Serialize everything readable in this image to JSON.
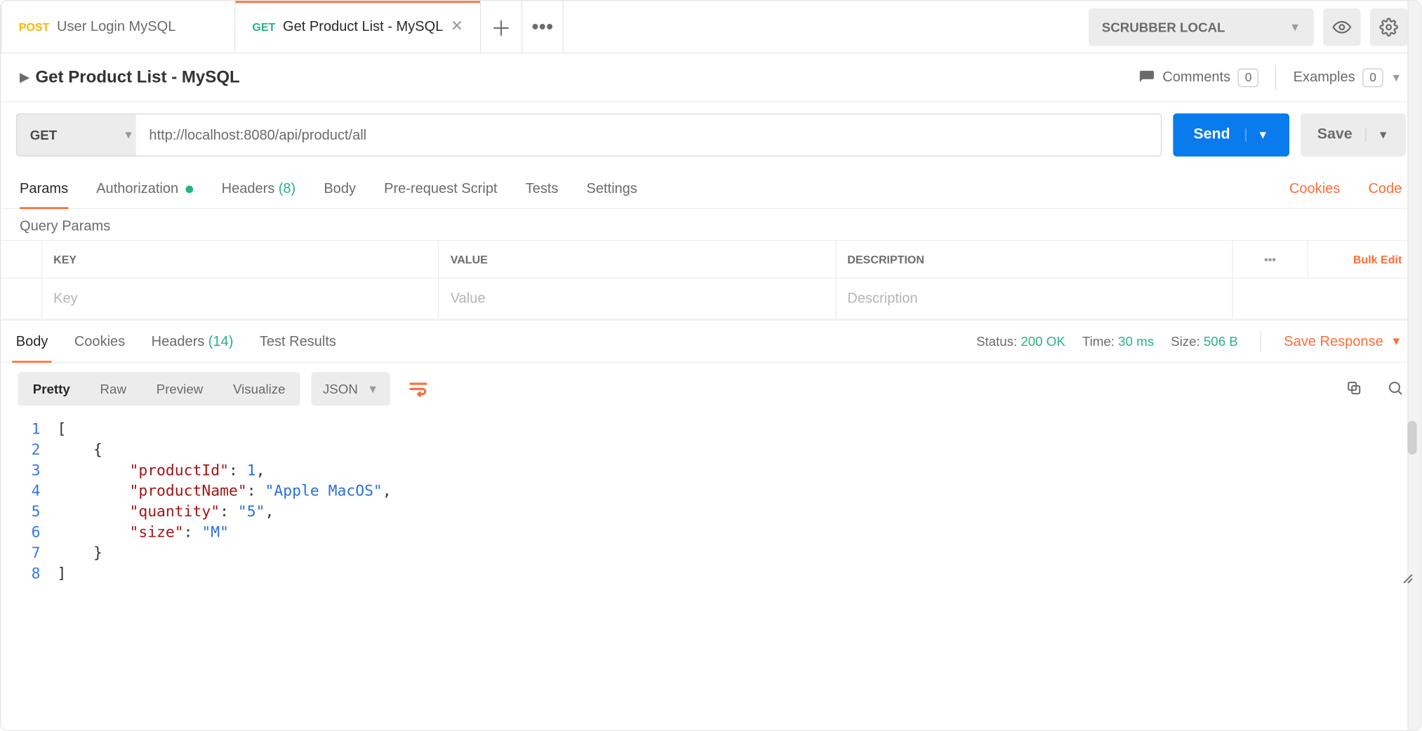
{
  "environment": {
    "name": "SCRUBBER LOCAL"
  },
  "tabs": [
    {
      "method": "POST",
      "title": "User Login MySQL",
      "active": false
    },
    {
      "method": "GET",
      "title": "Get Product List - MySQL",
      "active": true
    }
  ],
  "request": {
    "name": "Get Product List - MySQL",
    "comments": {
      "label": "Comments",
      "count": "0"
    },
    "examples": {
      "label": "Examples",
      "count": "0"
    },
    "method": "GET",
    "url": "http://localhost:8080/api/product/all",
    "send_label": "Send",
    "save_label": "Save"
  },
  "request_tabs": {
    "params": "Params",
    "authorization": "Authorization",
    "headers": "Headers",
    "headers_count": "(8)",
    "body": "Body",
    "prerequest": "Pre-request Script",
    "tests": "Tests",
    "settings": "Settings",
    "cookies_link": "Cookies",
    "code_link": "Code"
  },
  "query_params": {
    "section_label": "Query Params",
    "head": {
      "key": "KEY",
      "value": "VALUE",
      "description": "DESCRIPTION",
      "bulk_edit": "Bulk Edit"
    },
    "placeholders": {
      "key": "Key",
      "value": "Value",
      "description": "Description"
    }
  },
  "response_tabs": {
    "body": "Body",
    "cookies": "Cookies",
    "headers": "Headers",
    "headers_count": "(14)",
    "test_results": "Test Results"
  },
  "response_meta": {
    "status_lbl": "Status:",
    "status_val": "200 OK",
    "time_lbl": "Time:",
    "time_val": "30 ms",
    "size_lbl": "Size:",
    "size_val": "506 B",
    "save_response": "Save Response"
  },
  "response_toolbar": {
    "pretty": "Pretty",
    "raw": "Raw",
    "preview": "Preview",
    "visualize": "Visualize",
    "format": "JSON"
  },
  "response_body": {
    "lines": [
      "1",
      "2",
      "3",
      "4",
      "5",
      "6",
      "7",
      "8"
    ],
    "l1": "[",
    "l2_indent": "    ",
    "l2": "{",
    "kv_indent": "        ",
    "k1": "\"productId\"",
    "v1": "1",
    "k2": "\"productName\"",
    "v2": "\"Apple MacOS\"",
    "k3": "\"quantity\"",
    "v3": "\"5\"",
    "k4": "\"size\"",
    "v4": "\"M\"",
    "l7_indent": "    ",
    "l7": "}",
    "l8": "]"
  }
}
